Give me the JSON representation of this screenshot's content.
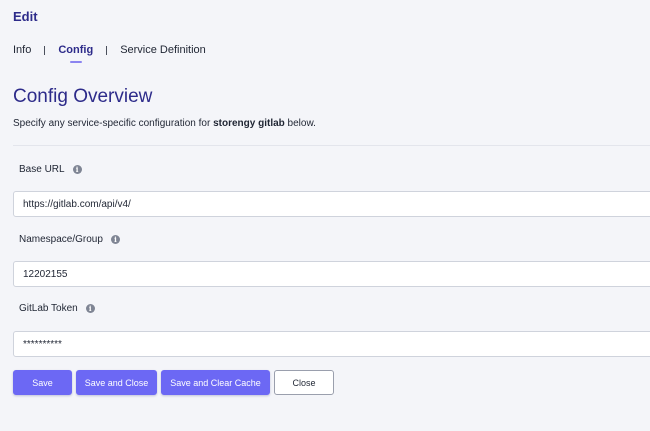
{
  "header": {
    "title": "Edit"
  },
  "tabs": [
    {
      "label": "Info",
      "active": false
    },
    {
      "label": "Config",
      "active": true
    },
    {
      "label": "Service Definition",
      "active": false
    }
  ],
  "section": {
    "title": "Config Overview",
    "description_prefix": "Specify any service-specific configuration for ",
    "service_name": "storengy gitlab",
    "description_suffix": " below."
  },
  "fields": [
    {
      "label": "Base URL",
      "value": "https://gitlab.com/api/v4/",
      "icon": "info-icon"
    },
    {
      "label": "Namespace/Group",
      "value": "12202155",
      "icon": "info-icon"
    },
    {
      "label": "GitLab Token",
      "value": "**********",
      "icon": "info-icon"
    }
  ],
  "actions": {
    "save": "Save",
    "save_close": "Save and Close",
    "save_clear_cache": "Save and Clear Cache",
    "close": "Close"
  },
  "colors": {
    "accent": "#6c68f4",
    "title": "#2d2b8a",
    "background": "#f4f5f9"
  }
}
